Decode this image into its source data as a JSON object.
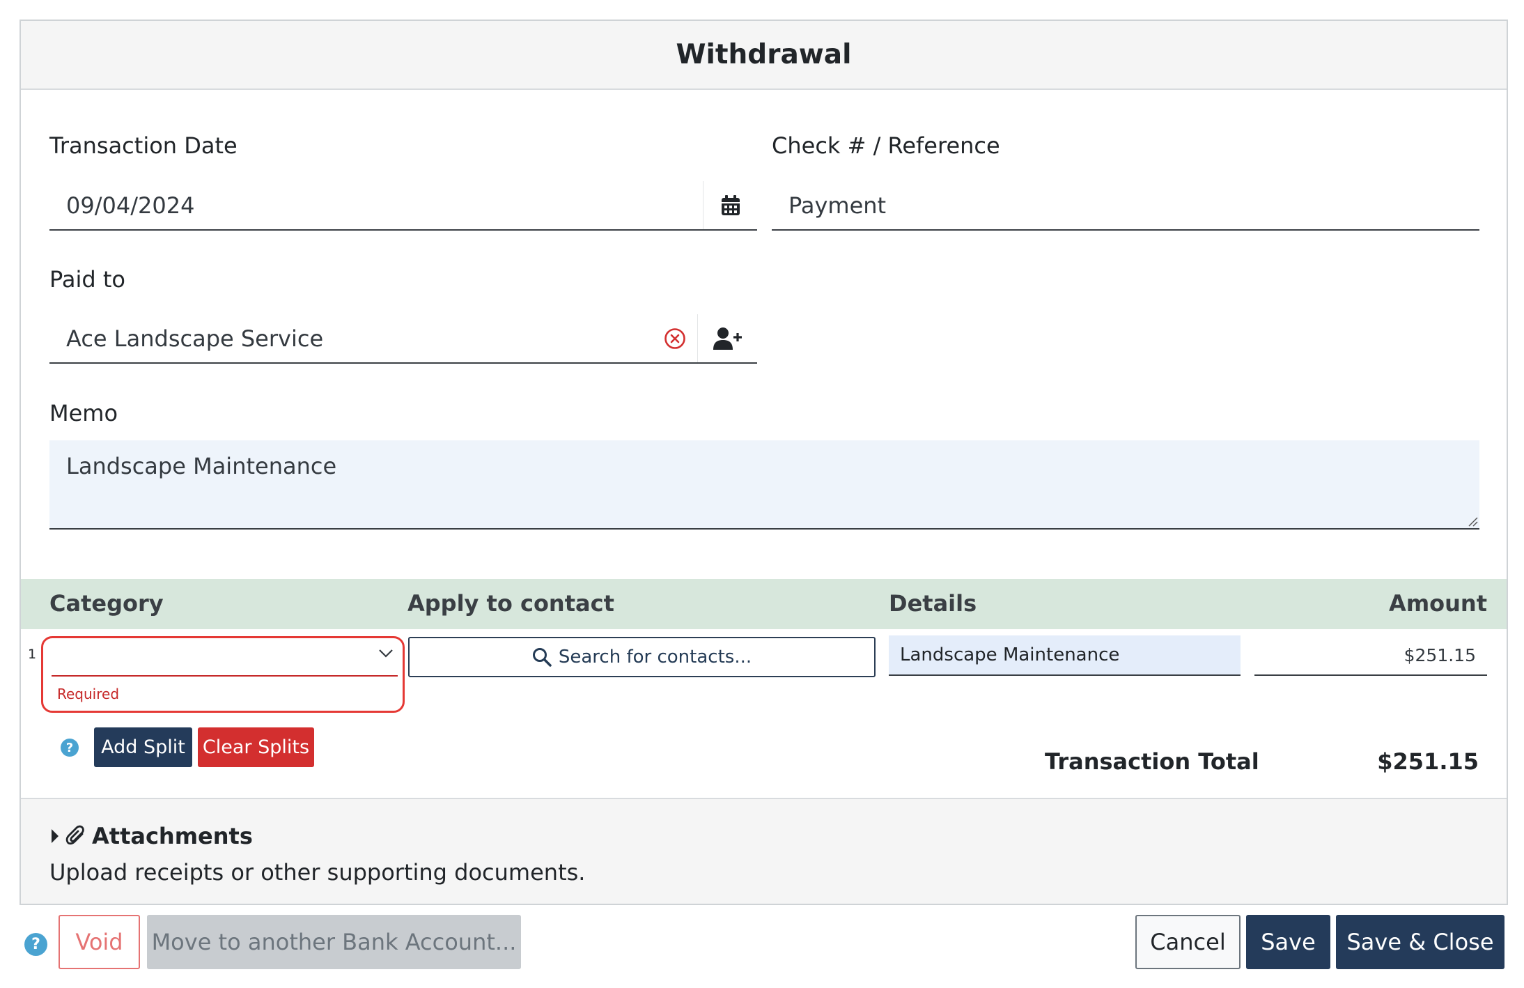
{
  "modal": {
    "title": "Withdrawal"
  },
  "form": {
    "transaction_date": {
      "label": "Transaction Date",
      "value": "09/04/2024"
    },
    "reference": {
      "label": "Check # / Reference",
      "value": "Payment"
    },
    "paid_to": {
      "label": "Paid to",
      "value": "Ace Landscape Service"
    },
    "memo": {
      "label": "Memo",
      "value": "Landscape Maintenance"
    }
  },
  "splits": {
    "headers": {
      "category": "Category",
      "contact": "Apply to contact",
      "details": "Details",
      "amount": "Amount"
    },
    "rows": [
      {
        "number": "1",
        "category": "",
        "category_error": "Required",
        "contact_placeholder": "Search for contacts...",
        "details": "Landscape Maintenance",
        "amount": "$251.15"
      }
    ],
    "add_split_label": "Add Split",
    "clear_splits_label": "Clear Splits",
    "help_glyph": "?",
    "total_label": "Transaction Total",
    "total_value": "$251.15"
  },
  "attachments": {
    "title": "Attachments",
    "description": "Upload receipts or other supporting documents."
  },
  "footer": {
    "help_glyph": "?",
    "void_label": "Void",
    "move_label": "Move to another Bank Account...",
    "cancel_label": "Cancel",
    "save_label": "Save",
    "save_close_label": "Save & Close"
  },
  "colors": {
    "navy": "#243b5a",
    "danger": "#d32f2f",
    "split_header_bg": "#d7e7dc",
    "help_blue": "#4aa3d1"
  },
  "icons": {
    "date_picker": "calendar-icon",
    "clear": "clear-circle-x-icon",
    "add_contact": "user-plus-icon",
    "dropdown": "chevron-down-icon",
    "search": "search-icon",
    "help": "question-circle-icon",
    "expand": "caret-right-icon",
    "attachment": "paperclip-icon"
  }
}
